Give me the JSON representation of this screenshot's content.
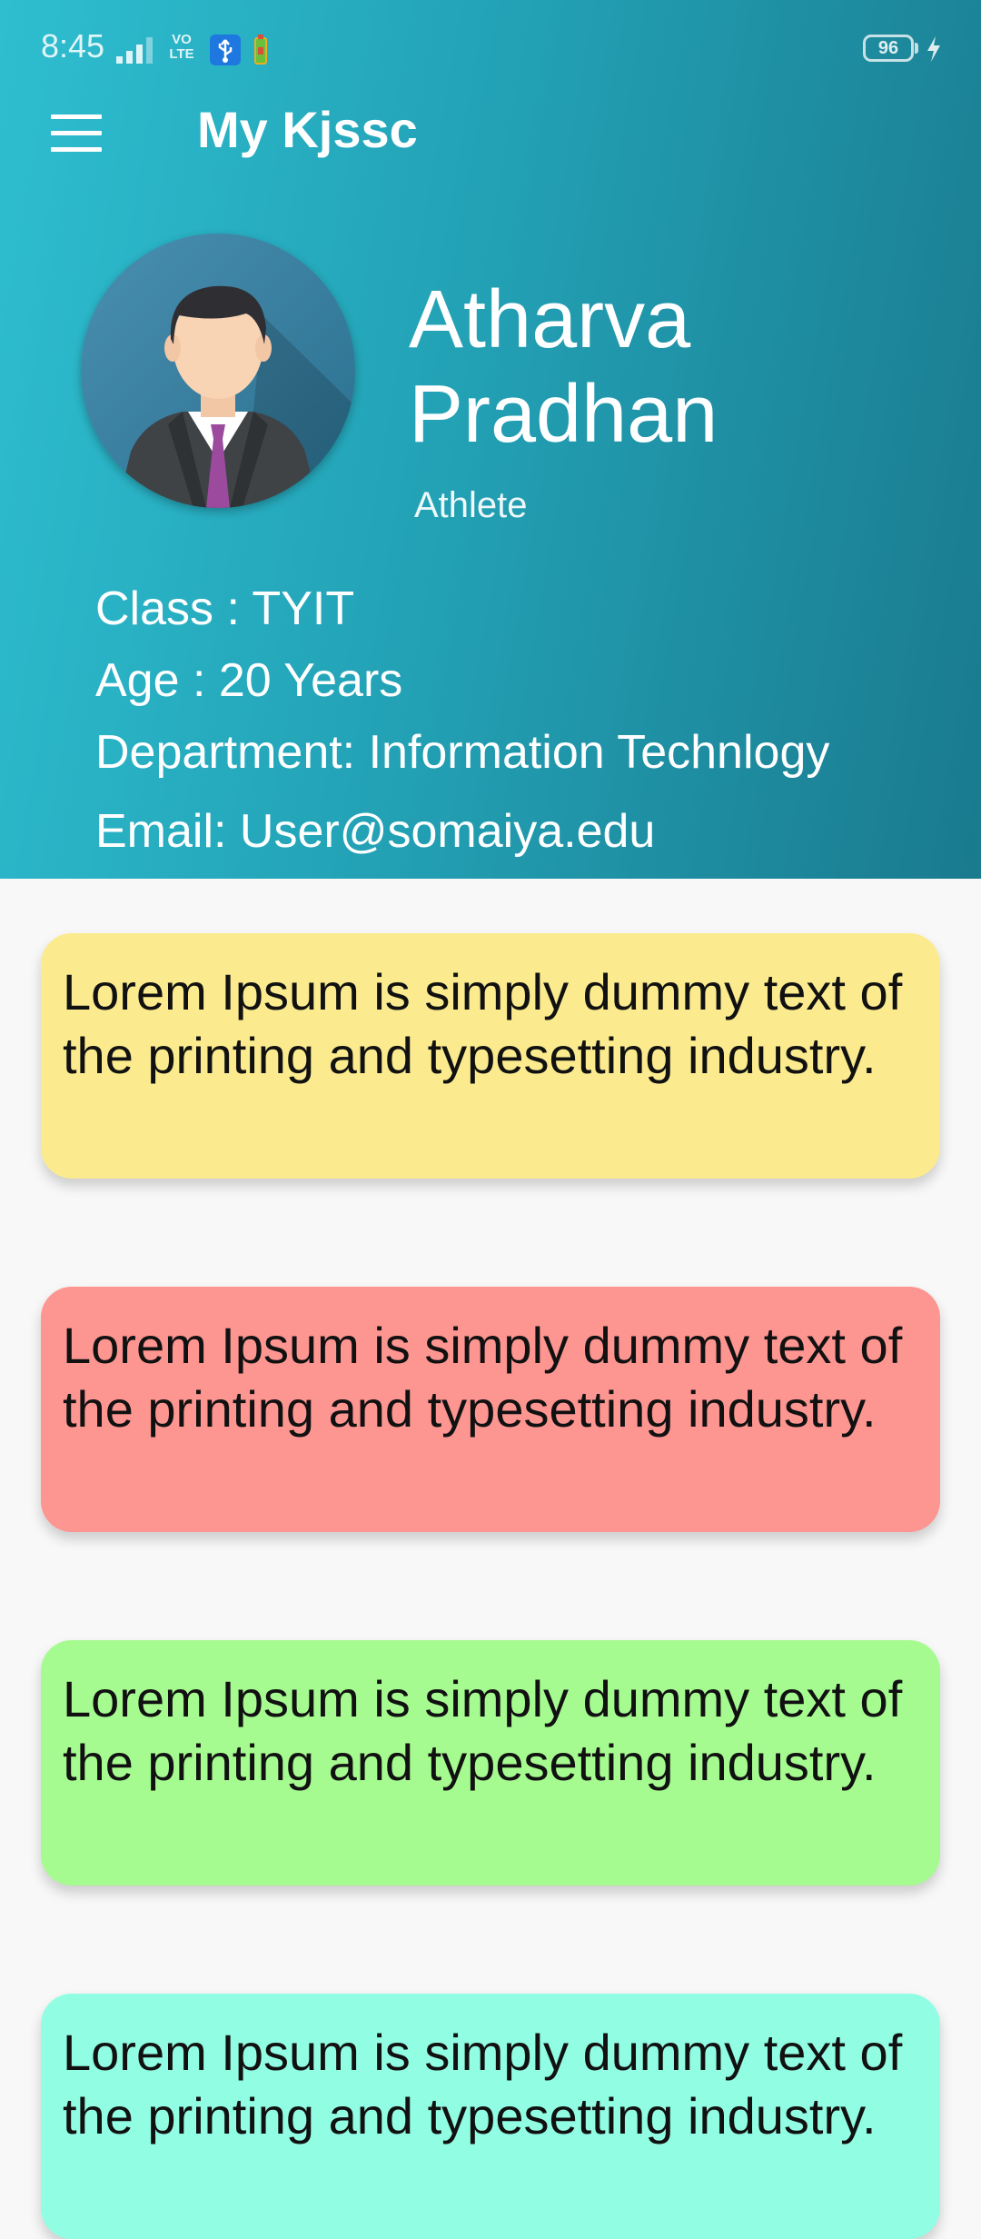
{
  "status_bar": {
    "time": "8:45",
    "network_label": "VO\nLTE",
    "battery_level": "96",
    "icons": [
      "signal-icon",
      "usb-icon",
      "app-notification-icon",
      "battery-icon",
      "charging-icon"
    ]
  },
  "toolbar": {
    "menu_icon": "hamburger-menu-icon",
    "title": "My Kjssc"
  },
  "profile": {
    "name": "Atharva Pradhan",
    "role": "Athlete",
    "avatar_icon": "user-avatar-icon",
    "class_line": "Class : TYIT",
    "age_line": "Age : 20 Years",
    "department_line": "Department: Information Technlogy",
    "email_line": "Email: User@somaiya.edu"
  },
  "colors": {
    "header_gradient_start": "#2ebed0",
    "header_gradient_end": "#1a7a8e",
    "background": "#f8f8f8",
    "card_yellow": "#fbeb8e",
    "card_red": "#fd9591",
    "card_green": "#a6fb90",
    "card_teal": "#91fde3"
  },
  "cards": [
    {
      "text": "Lorem Ipsum is simply dummy text of the printing and typesetting industry.",
      "color": "#fbeb8e"
    },
    {
      "text": "Lorem Ipsum is simply dummy text of the printing and typesetting industry.",
      "color": "#fd9591"
    },
    {
      "text": "Lorem Ipsum is simply dummy text of the printing and typesetting industry.",
      "color": "#a6fb90"
    },
    {
      "text": "Lorem Ipsum is simply dummy text of the printing and typesetting industry.",
      "color": "#91fde3"
    }
  ]
}
